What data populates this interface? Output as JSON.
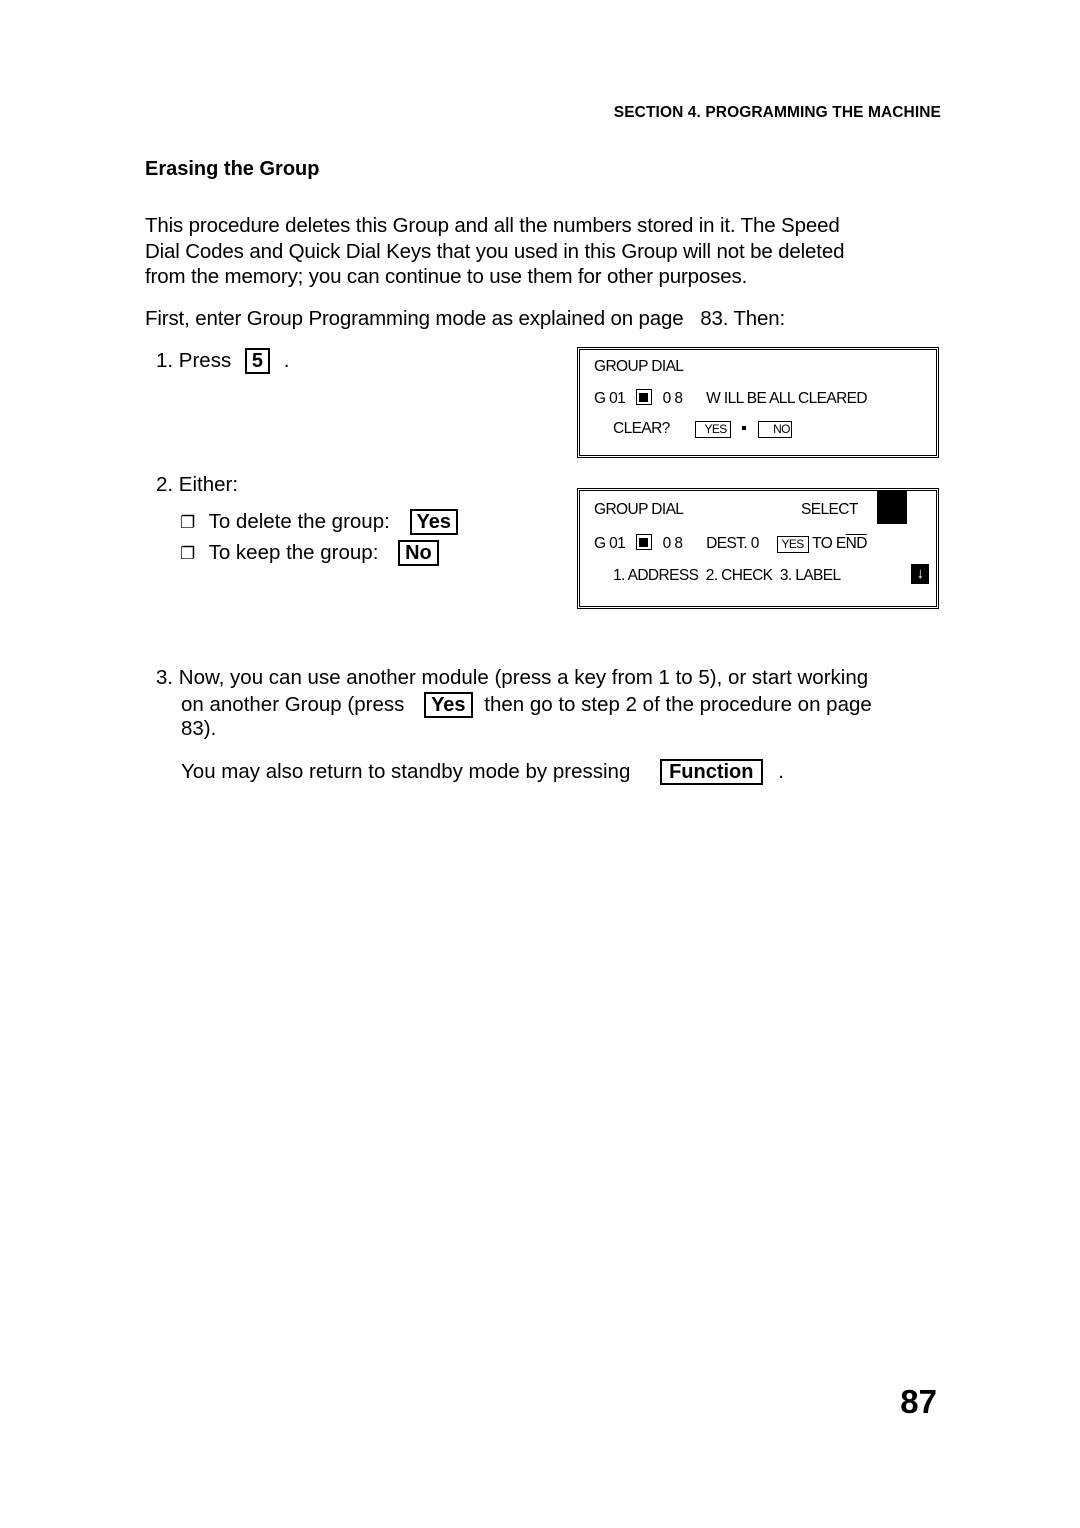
{
  "header": {
    "section_title": "SECTION 4. PROGRAMMING THE MACHINE"
  },
  "content": {
    "heading": "Erasing the Group",
    "intro_lines": [
      "This procedure deletes this Group and all the numbers stored in it. The Speed",
      "Dial Codes and Quick Dial Keys that you used in this Group will not be deleted",
      "from the memory; you can continue to use them for other purposes."
    ],
    "first_line": "First, enter Group Programming mode as explained on page   83. Then:",
    "step1": {
      "prefix": "1. Press",
      "key": "5",
      "suffix": "."
    },
    "step2": {
      "label": "2. Either:",
      "options": [
        {
          "bullet": "❐",
          "text": "To delete the group:",
          "key": "Yes"
        },
        {
          "bullet": "❐",
          "text": "To keep the group:",
          "key": "No"
        }
      ]
    },
    "step3": {
      "line1": "3. Now, you can use another module (press a key from 1 to 5), or start working",
      "line2_prefix": "on another Group (press",
      "line2_key": "Yes",
      "line2_suffix": "then go to step 2 of the procedure on page",
      "line3": "83).",
      "standby_prefix": "You may also return to standby mode by pressing",
      "standby_key": "Function",
      "standby_suffix": "."
    }
  },
  "displays": {
    "lcd1": {
      "line1": "GROUP DIAL",
      "line2_group": "G 01",
      "line2_count": "0 8",
      "line2_msg": "W ILL BE ALL CLEARED",
      "line3_prompt": "CLEAR?",
      "yes": "YES",
      "no": "NO"
    },
    "lcd2": {
      "line1": "GROUP DIAL",
      "line1_right": "SELECT",
      "line2_group": "G 01",
      "line2_count": "0 8",
      "line2_dest": "DEST. 0",
      "yes": "YES",
      "line2_to": "TO E",
      "line2_end": "ND",
      "line3": "1. ADDRESS  2. CHECK  3. LABEL",
      "arrow": "↓"
    }
  },
  "footer": {
    "page_number": "87"
  }
}
